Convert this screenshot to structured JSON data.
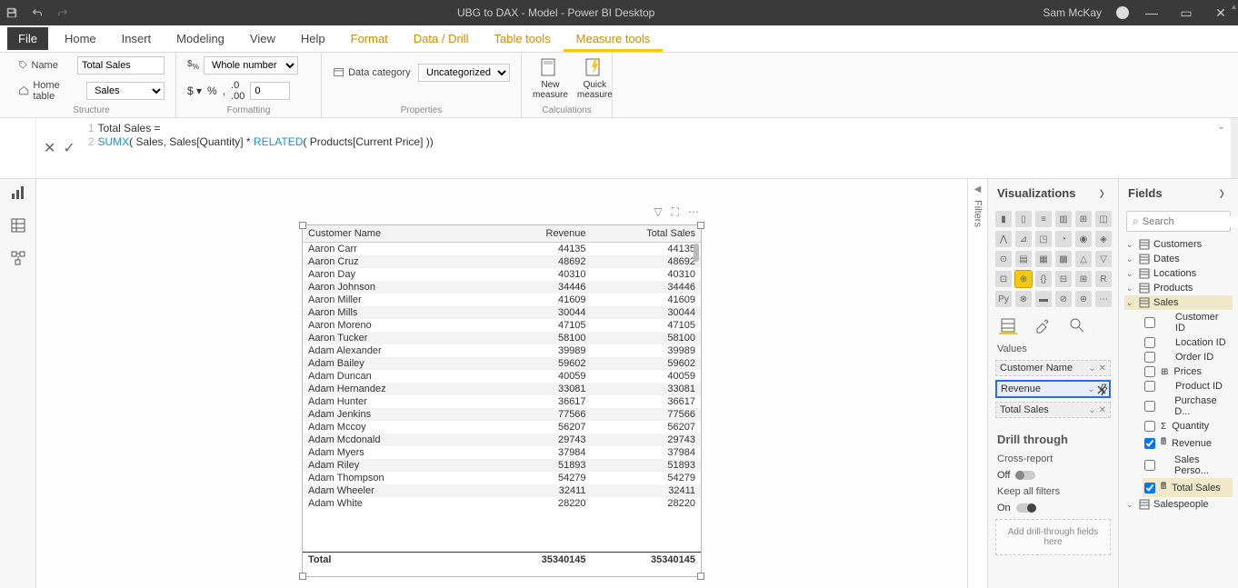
{
  "titlebar": {
    "title": "UBG to DAX - Model - Power BI Desktop",
    "user": "Sam McKay"
  },
  "tabs": {
    "file": "File",
    "home": "Home",
    "insert": "Insert",
    "modeling": "Modeling",
    "view": "View",
    "help": "Help",
    "format": "Format",
    "datadrill": "Data / Drill",
    "tabletools": "Table tools",
    "measuretools": "Measure tools"
  },
  "ribbon": {
    "structure": {
      "label": "Structure",
      "name_label": "Name",
      "name_value": "Total Sales",
      "hometable_label": "Home table",
      "hometable_value": "Sales"
    },
    "formatting": {
      "label": "Formatting",
      "format_value": "Whole number",
      "decimal_value": "0"
    },
    "properties": {
      "label": "Properties",
      "datacat_label": "Data category",
      "datacat_value": "Uncategorized"
    },
    "calculations": {
      "label": "Calculations",
      "newmeasure": "New\nmeasure",
      "quickmeasure": "Quick\nmeasure"
    }
  },
  "formula": {
    "line1": "Total Sales =",
    "line2_pre": "SUMX",
    "line2_mid": "( Sales, Sales[Quantity] * ",
    "line2_kw": "RELATED",
    "line2_post": "( Products[Current Price] ))"
  },
  "table": {
    "columns": [
      "Customer Name",
      "Revenue",
      "Total Sales"
    ],
    "rows": [
      [
        "Aaron Carr",
        "44135",
        "44135"
      ],
      [
        "Aaron Cruz",
        "48692",
        "48692"
      ],
      [
        "Aaron Day",
        "40310",
        "40310"
      ],
      [
        "Aaron Johnson",
        "34446",
        "34446"
      ],
      [
        "Aaron Miller",
        "41609",
        "41609"
      ],
      [
        "Aaron Mills",
        "30044",
        "30044"
      ],
      [
        "Aaron Moreno",
        "47105",
        "47105"
      ],
      [
        "Aaron Tucker",
        "58100",
        "58100"
      ],
      [
        "Adam Alexander",
        "39989",
        "39989"
      ],
      [
        "Adam Bailey",
        "59602",
        "59602"
      ],
      [
        "Adam Duncan",
        "40059",
        "40059"
      ],
      [
        "Adam Hernandez",
        "33081",
        "33081"
      ],
      [
        "Adam Hunter",
        "36617",
        "36617"
      ],
      [
        "Adam Jenkins",
        "77566",
        "77566"
      ],
      [
        "Adam Mccoy",
        "56207",
        "56207"
      ],
      [
        "Adam Mcdonald",
        "29743",
        "29743"
      ],
      [
        "Adam Myers",
        "37984",
        "37984"
      ],
      [
        "Adam Riley",
        "51893",
        "51893"
      ],
      [
        "Adam Thompson",
        "54279",
        "54279"
      ],
      [
        "Adam Wheeler",
        "32411",
        "32411"
      ],
      [
        "Adam White",
        "28220",
        "28220"
      ]
    ],
    "total_label": "Total",
    "total_rev": "35340145",
    "total_sales": "35340145"
  },
  "viz": {
    "title": "Visualizations",
    "values_label": "Values",
    "wells": [
      "Customer Name",
      "Revenue",
      "Total Sales"
    ],
    "drill_title": "Drill through",
    "crossreport": "Cross-report",
    "off": "Off",
    "keepfilters": "Keep all filters",
    "on": "On",
    "drillbox": "Add drill-through fields here"
  },
  "fields": {
    "title": "Fields",
    "search_placeholder": "Search",
    "tables": [
      "Customers",
      "Dates",
      "Locations",
      "Products",
      "Sales",
      "Salespeople"
    ],
    "sales_fields": [
      {
        "name": "Customer ID",
        "checked": false
      },
      {
        "name": "Location ID",
        "checked": false
      },
      {
        "name": "Order ID",
        "checked": false
      },
      {
        "name": "Prices",
        "checked": false,
        "hier": true
      },
      {
        "name": "Product ID",
        "checked": false
      },
      {
        "name": "Purchase D...",
        "checked": false
      },
      {
        "name": "Quantity",
        "checked": false,
        "sigma": true
      },
      {
        "name": "Revenue",
        "checked": true,
        "calc": true
      },
      {
        "name": "Sales Perso...",
        "checked": false
      },
      {
        "name": "Total Sales",
        "checked": true,
        "calc": true,
        "sel": true
      }
    ]
  },
  "filters_label": "Filters"
}
